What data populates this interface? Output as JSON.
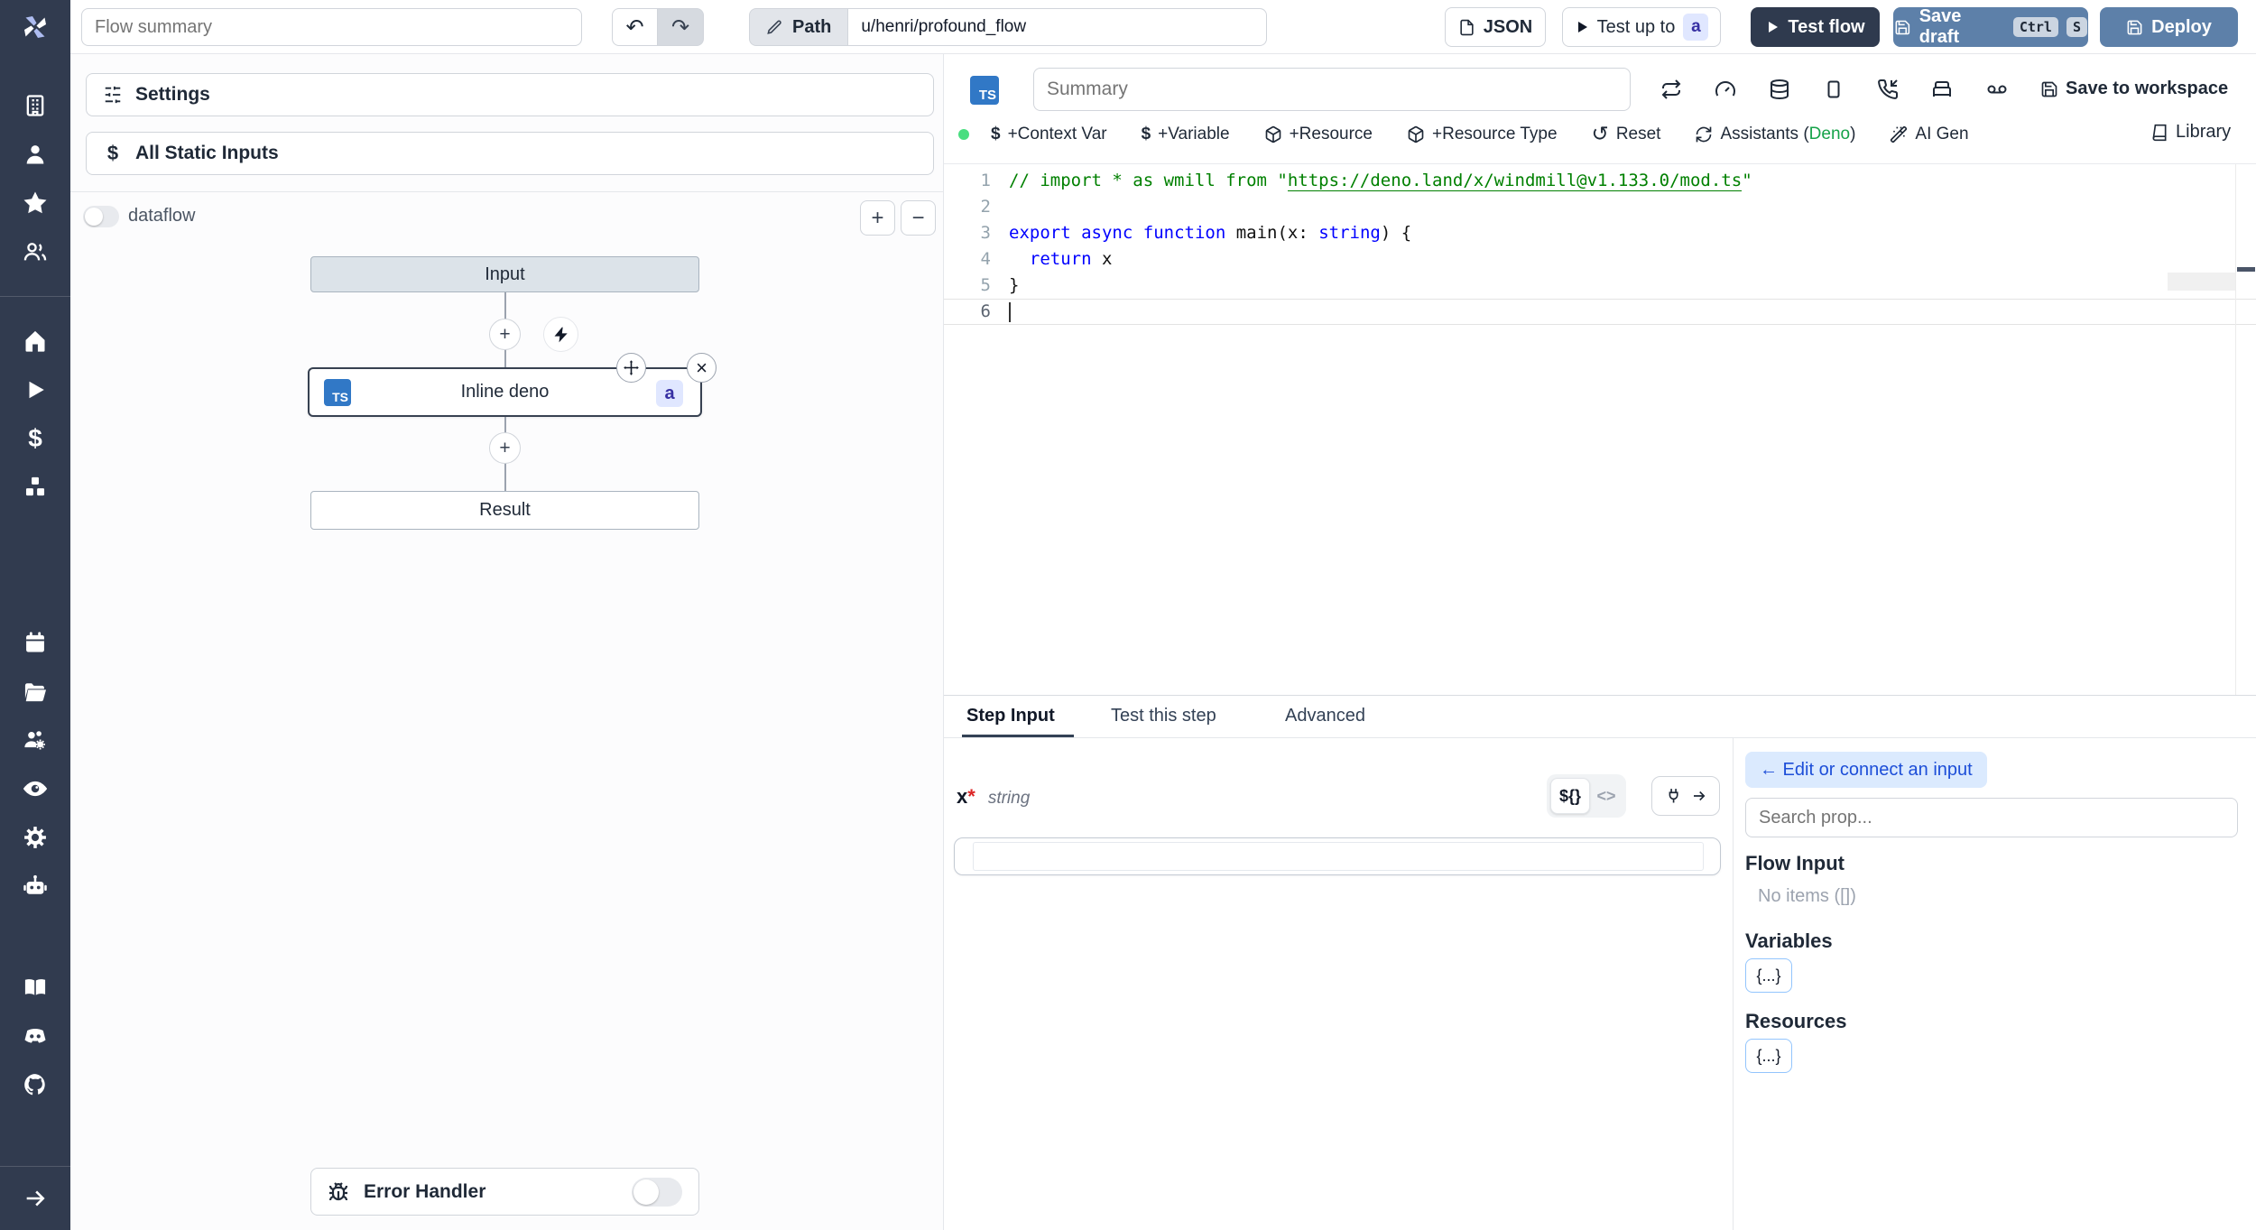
{
  "colors": {
    "sidebar_bg": "#313b4f",
    "accent_steel_blue": "#5d80a9",
    "dark_button": "#2f3a4e",
    "ts_badge_blue": "#3178c6",
    "badge_lavender_bg": "#e0e7ff",
    "badge_lavender_text": "#3730a3",
    "green_status_dot": "#4ade80",
    "deno_green": "#16a34a",
    "comment_green": "#008000",
    "keyword_blue": "#0000ff"
  },
  "topbar": {
    "flow_summary_placeholder": "Flow summary",
    "undo_glyph": "↶",
    "redo_glyph": "↷",
    "path_label": "Path",
    "path_value": "u/henri/profound_flow",
    "json_label": "JSON",
    "test_up_to_label": "Test up to",
    "test_up_to_badge": "a",
    "test_flow_label": "Test flow",
    "save_draft_label": "Save draft",
    "kbd_ctrl": "Ctrl",
    "kbd_s": "S",
    "deploy_label": "Deploy"
  },
  "sidebar": {
    "icons": [
      "windmill-logo",
      "workspace-building",
      "user",
      "favorites-star",
      "groups-users",
      "home",
      "runs-play",
      "variables-dollar",
      "resources-boxes",
      "schedules-calendar",
      "folders",
      "workers-groups",
      "audit-eye",
      "settings-gear",
      "ai-bot",
      "docs-book",
      "discord",
      "github",
      "expand-arrow"
    ]
  },
  "flow_panel": {
    "settings_label": "Settings",
    "static_inputs_label": "All Static Inputs",
    "dataflow_label": "dataflow",
    "zoom_in_glyph": "+",
    "zoom_out_glyph": "−",
    "graph": {
      "input_node": "Input",
      "step_node": "Inline deno",
      "step_lang_badge": "TS",
      "step_id_badge": "a",
      "result_node": "Result",
      "close_glyph": "×"
    },
    "error_handler_label": "Error Handler"
  },
  "editor": {
    "lang_badge": "TS",
    "summary_placeholder": "Summary",
    "save_to_workspace_label": "Save to workspace",
    "toolbar": {
      "context_var": "+Context Var",
      "variable": "+Variable",
      "resource": "+Resource",
      "resource_type": "+Resource Type",
      "reset": "Reset",
      "reset_glyph": "↺",
      "assistants_prefix": "Assistants (",
      "assistants_lang": "Deno",
      "assistants_suffix": ")",
      "ai_gen": "AI Gen",
      "library": "Library",
      "dollar_glyph": "$"
    },
    "code": {
      "lines": [
        {
          "num": "1",
          "segments": [
            {
              "t": "// import * as wmill from \"",
              "c": "comment"
            },
            {
              "t": "https://deno.land/x/windmill@v1.133.0/mod.ts",
              "c": "comment-link"
            },
            {
              "t": "\"",
              "c": "comment"
            }
          ]
        },
        {
          "num": "2",
          "segments": []
        },
        {
          "num": "3",
          "segments": [
            {
              "t": "export",
              "c": "kw"
            },
            {
              "t": " ",
              "c": "plain"
            },
            {
              "t": "async",
              "c": "kw"
            },
            {
              "t": " ",
              "c": "plain"
            },
            {
              "t": "function",
              "c": "kw"
            },
            {
              "t": " main(x: ",
              "c": "plain"
            },
            {
              "t": "string",
              "c": "kw"
            },
            {
              "t": ") {",
              "c": "plain"
            }
          ]
        },
        {
          "num": "4",
          "segments": [
            {
              "t": "  ",
              "c": "plain"
            },
            {
              "t": "return",
              "c": "kw"
            },
            {
              "t": " x",
              "c": "plain"
            }
          ]
        },
        {
          "num": "5",
          "segments": [
            {
              "t": "}",
              "c": "plain"
            }
          ]
        },
        {
          "num": "6",
          "segments": [],
          "cursor": true,
          "current": true
        }
      ]
    }
  },
  "bottom": {
    "tabs": [
      "Step Input",
      "Test this step",
      "Advanced"
    ],
    "active_tab": "Step Input",
    "field": {
      "name": "x",
      "required_mark": "*",
      "type": "string",
      "expr_toggle": "${}",
      "code_toggle": "<>",
      "value": ""
    },
    "connect_panel": {
      "back_label": "← Edit or connect an input",
      "search_placeholder": "Search prop...",
      "flow_input_title": "Flow Input",
      "flow_input_empty": "No items ([])",
      "variables_title": "Variables",
      "variables_button": "{...}",
      "resources_title": "Resources",
      "resources_button": "{...}"
    }
  }
}
